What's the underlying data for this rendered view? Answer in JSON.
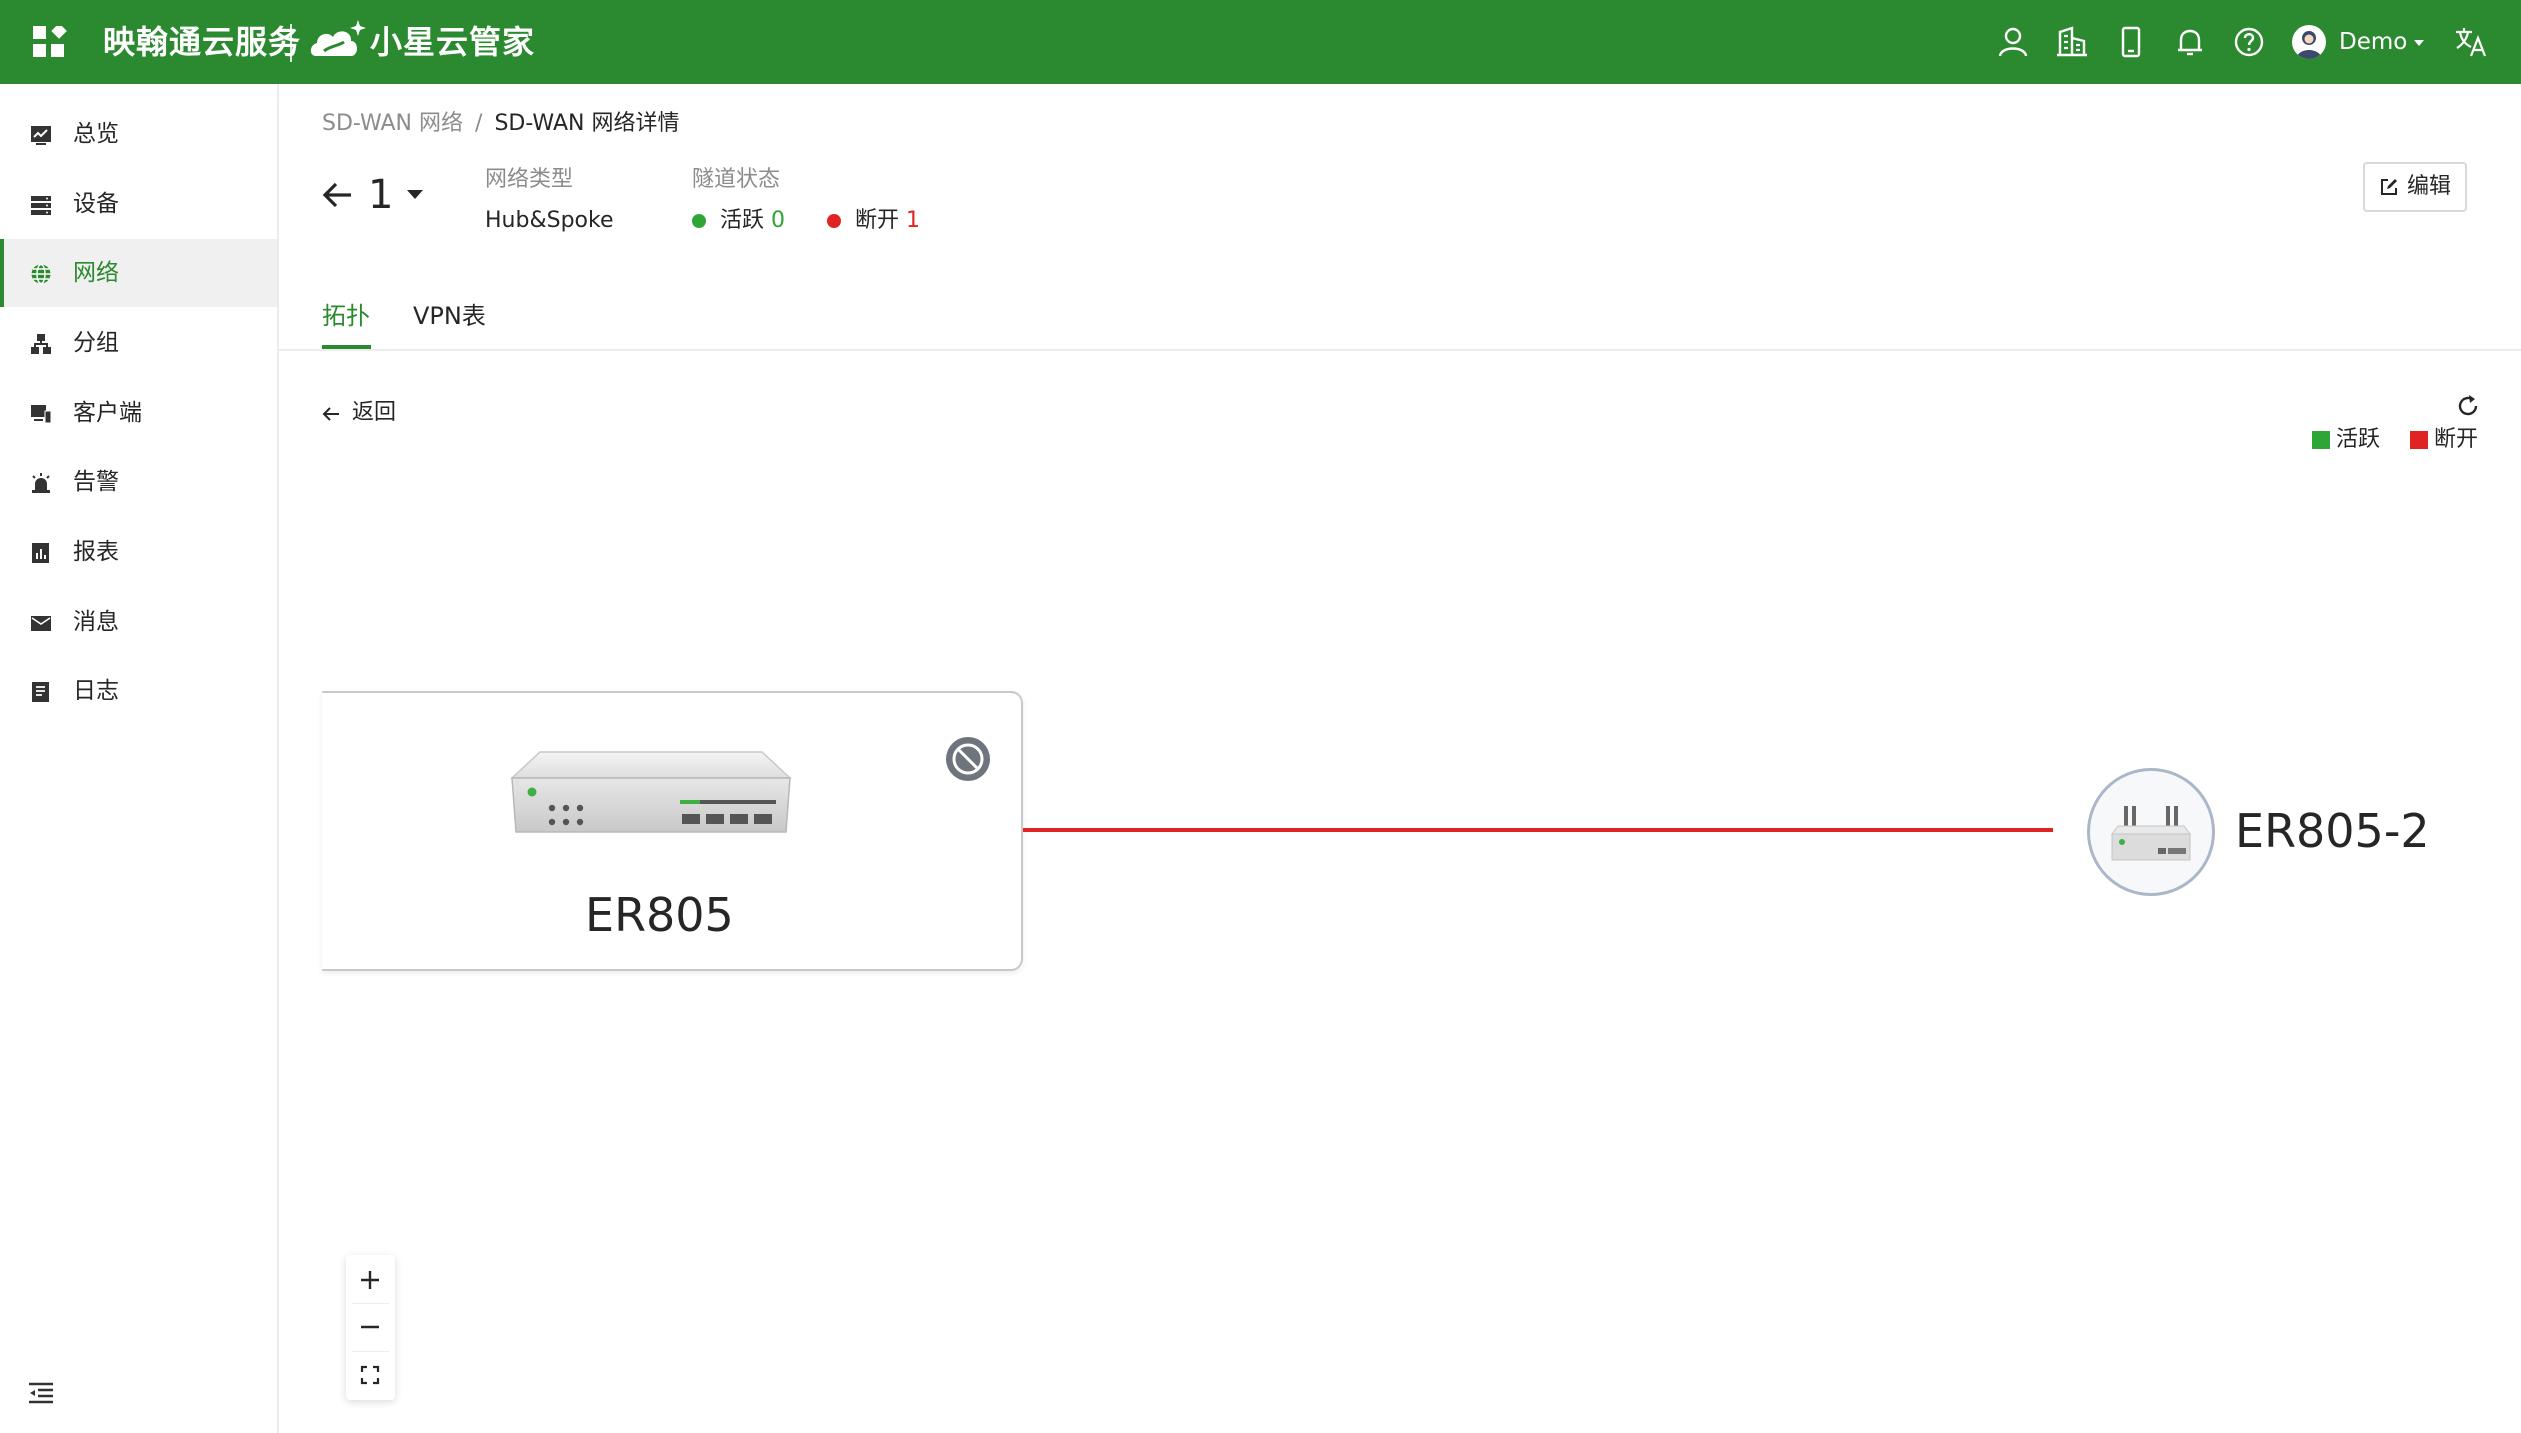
{
  "topbar": {
    "brand": "映翰通云服务",
    "product": "小星云管家",
    "user": "Demo",
    "icons": [
      "user-icon",
      "building-icon",
      "mobile-icon",
      "bell-icon",
      "help-icon",
      "translate-icon"
    ]
  },
  "sidebar": {
    "items": [
      {
        "label": "总览",
        "icon": "overview-icon"
      },
      {
        "label": "设备",
        "icon": "device-icon"
      },
      {
        "label": "网络",
        "icon": "globe-icon",
        "active": true
      },
      {
        "label": "分组",
        "icon": "group-icon"
      },
      {
        "label": "客户端",
        "icon": "client-icon"
      },
      {
        "label": "告警",
        "icon": "alarm-icon"
      },
      {
        "label": "报表",
        "icon": "report-icon"
      },
      {
        "label": "消息",
        "icon": "message-icon"
      },
      {
        "label": "日志",
        "icon": "log-icon"
      }
    ]
  },
  "breadcrumb": {
    "parent": "SD-WAN 网络",
    "separator": "/",
    "current": "SD-WAN 网络详情"
  },
  "network": {
    "name": "1",
    "type_label": "网络类型",
    "type_value": "Hub&Spoke",
    "tunnel_label": "隧道状态",
    "active_label": "活跃",
    "active_count": "0",
    "down_label": "断开",
    "down_count": "1"
  },
  "edit_label": "编辑",
  "tabs": [
    {
      "label": "拓扑",
      "active": true
    },
    {
      "label": "VPN表",
      "active": false
    }
  ],
  "topology": {
    "back_label": "返回",
    "legend": [
      {
        "label": "活跃",
        "color": "#2ea637"
      },
      {
        "label": "断开",
        "color": "#e02424"
      }
    ],
    "hub": {
      "name": "ER805"
    },
    "spoke": {
      "name": "ER805-2"
    },
    "link_status": "断开"
  },
  "colors": {
    "brand": "#2b8a2f",
    "active": "#2ea637",
    "down": "#e02424"
  }
}
